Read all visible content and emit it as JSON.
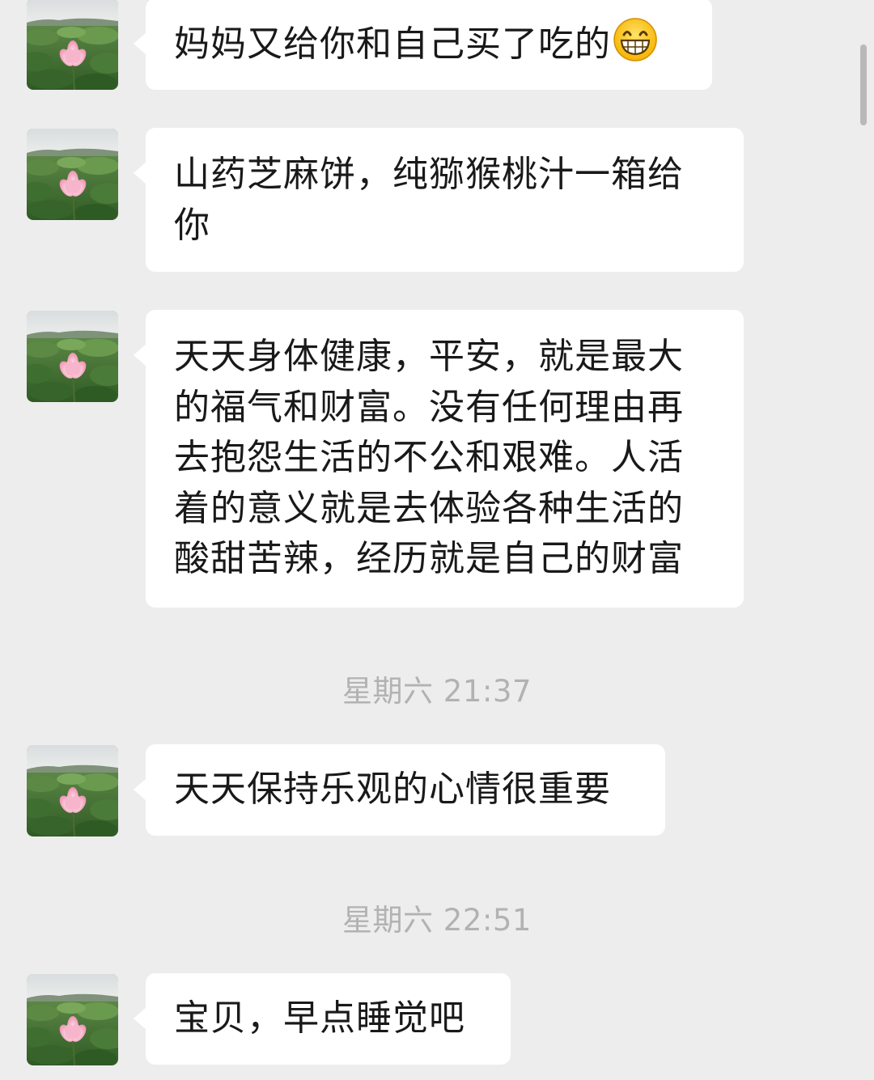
{
  "messages": [
    {
      "text": "妈妈又给你和自己买了吃的",
      "emoji": "grinning-face-emoji"
    },
    {
      "text": "山药芝麻饼，纯猕猴桃汁一箱给你"
    },
    {
      "text": "天天身体健康，平安，就是最大的福气和财富。没有任何理由再去抱怨生活的不公和艰难。人活着的意义就是去体验各种生活的酸甜苦辣，经历就是自己的财富"
    },
    {
      "text": "天天保持乐观的心情很重要"
    },
    {
      "text": "宝贝，早点睡觉吧"
    }
  ],
  "timestamps": [
    "星期六 21:37",
    "星期六 22:51"
  ],
  "avatar": {
    "icon": "lotus-flower-avatar"
  },
  "colors": {
    "background": "#ededed",
    "bubble": "#ffffff",
    "text": "#191919",
    "timestamp": "#b2b2b2"
  }
}
